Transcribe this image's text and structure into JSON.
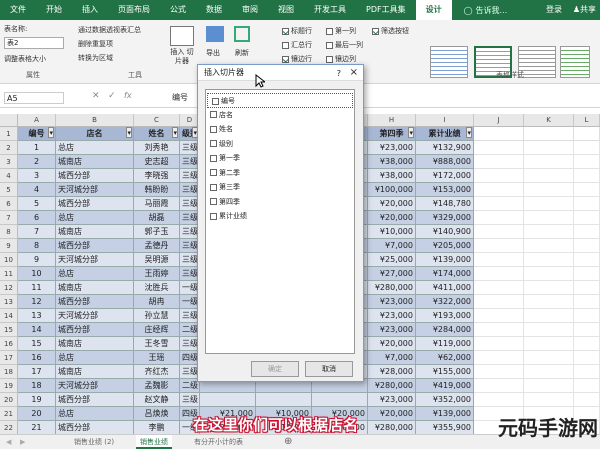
{
  "ribbon_tabs": [
    "文件",
    "开始",
    "插入",
    "页面布局",
    "公式",
    "数据",
    "审阅",
    "视图",
    "开发工具",
    "PDF工具集",
    "设计"
  ],
  "search_hint": "告诉我...",
  "login": "登录",
  "share": "共享",
  "ribbon": {
    "table_name_label": "表名称:",
    "table_name_value": "表2",
    "resize_btn": "调整表格大小",
    "properties_group": "属性",
    "pivot_summary": "通过数据透视表汇总",
    "remove_dups": "删除重复项",
    "convert_range": "转换为区域",
    "slicer_btn": "插入 切片器",
    "export_btn": "导出",
    "refresh_btn": "刷新",
    "tools_group": "工具",
    "header_row": "标题行",
    "first_col": "第一列",
    "filter_btn": "筛选按钮",
    "total_row": "汇总行",
    "last_col": "最后一列",
    "banded_rows": "镶边行",
    "banded_cols": "镶边列",
    "styles_group": "表格样式"
  },
  "formula": {
    "namebox": "A5",
    "content": "编号"
  },
  "columns": [
    "A",
    "B",
    "C",
    "D",
    "E",
    "F",
    "G",
    "H",
    "I",
    "J",
    "K",
    "L"
  ],
  "headers": {
    "a": "编号",
    "b": "店名",
    "c": "姓名",
    "d": "级别",
    "h": "第四季",
    "i": "累计业绩"
  },
  "rows": [
    {
      "a": "1",
      "b": "总店",
      "c": "刘秀艳",
      "d": "三级",
      "h": "¥23,000",
      "i": "¥132,900"
    },
    {
      "a": "2",
      "b": "城南店",
      "c": "史志超",
      "d": "三级",
      "h": "¥38,000",
      "i": "¥888,000"
    },
    {
      "a": "3",
      "b": "城西分部",
      "c": "李晓强",
      "d": "三级",
      "h": "¥38,000",
      "i": "¥172,000"
    },
    {
      "a": "4",
      "b": "天河城分部",
      "c": "韩盼盼",
      "d": "三级",
      "h": "¥100,000",
      "i": "¥153,000"
    },
    {
      "a": "5",
      "b": "城西分部",
      "c": "马丽霞",
      "d": "三级",
      "h": "¥20,000",
      "i": "¥148,780"
    },
    {
      "a": "6",
      "b": "总店",
      "c": "胡磊",
      "d": "三级",
      "h": "¥20,000",
      "i": "¥329,000"
    },
    {
      "a": "7",
      "b": "城南店",
      "c": "郭子玉",
      "d": "三级",
      "h": "¥10,000",
      "i": "¥140,900"
    },
    {
      "a": "8",
      "b": "城西分部",
      "c": "孟德丹",
      "d": "三级",
      "h": "¥7,000",
      "i": "¥205,000"
    },
    {
      "a": "9",
      "b": "天河城分部",
      "c": "吴明源",
      "d": "三级",
      "h": "¥25,000",
      "i": "¥139,000"
    },
    {
      "a": "10",
      "b": "总店",
      "c": "王雨婷",
      "d": "三级",
      "h": "¥27,000",
      "i": "¥174,000"
    },
    {
      "a": "11",
      "b": "城南店",
      "c": "沈胜兵",
      "d": "一级",
      "h": "¥280,000",
      "i": "¥411,000"
    },
    {
      "a": "12",
      "b": "城西分部",
      "c": "胡冉",
      "d": "一级",
      "h": "¥23,000",
      "i": "¥322,000"
    },
    {
      "a": "13",
      "b": "天河城分部",
      "c": "孙立慧",
      "d": "三级",
      "h": "¥23,000",
      "i": "¥193,000"
    },
    {
      "a": "14",
      "b": "城西分部",
      "c": "庄经辉",
      "d": "二级",
      "h": "¥23,000",
      "i": "¥284,000"
    },
    {
      "a": "15",
      "b": "城南店",
      "c": "王冬雪",
      "d": "三级",
      "h": "¥20,000",
      "i": "¥119,000"
    },
    {
      "a": "16",
      "b": "总店",
      "c": "王瑶",
      "d": "四级",
      "h": "¥7,000",
      "i": "¥62,000"
    },
    {
      "a": "17",
      "b": "城南店",
      "c": "齐红杰",
      "d": "三级",
      "h": "¥28,000",
      "i": "¥155,000"
    },
    {
      "a": "18",
      "b": "天河城分部",
      "c": "孟魏影",
      "d": "二级",
      "h": "¥280,000",
      "i": "¥419,000"
    },
    {
      "a": "19",
      "b": "城西分部",
      "c": "赵文静",
      "d": "三级",
      "h": "¥23,000",
      "i": "¥352,000"
    },
    {
      "a": "20",
      "b": "总店",
      "c": "吕焕焕",
      "d": "四级",
      "h": "¥20,000",
      "i": "¥139,000"
    },
    {
      "a": "21",
      "b": "城西分部",
      "c": "李鹏",
      "d": "一级",
      "h": "¥280,000",
      "i": "¥355,900"
    }
  ],
  "row20_hidden": {
    "e": "¥21,000",
    "f": "¥10,000",
    "g": "¥20,000"
  },
  "row21_hidden": {
    "e": "¥209,000",
    "f": "¥10,000",
    "g": "¥20,000"
  },
  "dialog": {
    "title": "插入切片器",
    "help": "?",
    "close": "×",
    "items": [
      "编号",
      "店名",
      "姓名",
      "级别",
      "第一季",
      "第二季",
      "第三季",
      "第四季",
      "累计业绩"
    ],
    "ok": "确定",
    "cancel": "取消"
  },
  "sheet_tabs": [
    "销售业绩 (2)",
    "销售业绩",
    "有分开小计的表"
  ],
  "caption": "在这里你们可以根据店名",
  "watermark": "元码手游网"
}
